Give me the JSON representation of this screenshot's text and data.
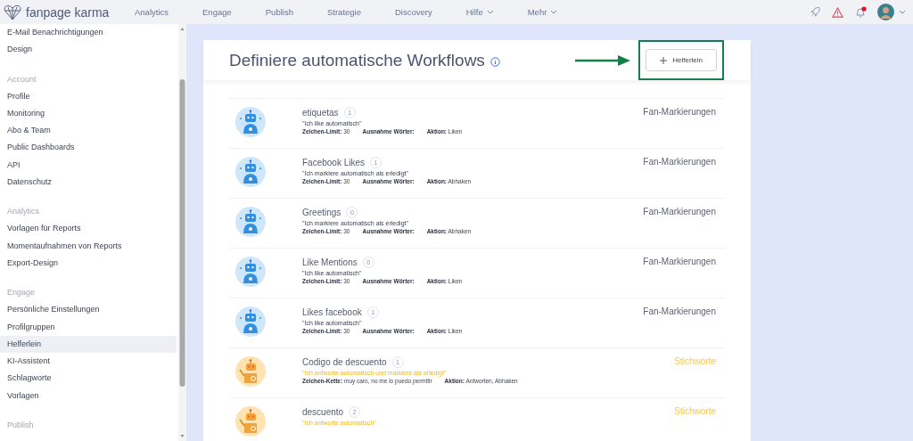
{
  "topbar": {
    "brand": "fanpage karma",
    "nav": [
      {
        "label": "Analytics",
        "dropdown": false
      },
      {
        "label": "Engage",
        "dropdown": false
      },
      {
        "label": "Publish",
        "dropdown": false
      },
      {
        "label": "Strategie",
        "dropdown": false
      },
      {
        "label": "Discovery",
        "dropdown": false
      },
      {
        "label": "Hilfe",
        "dropdown": true
      },
      {
        "label": "Mehr",
        "dropdown": true
      }
    ],
    "has_notification": true
  },
  "sidebar": {
    "sections": [
      {
        "items": [
          {
            "label": "E-Mail Benachrichtigungen",
            "selected": false
          },
          {
            "label": "Design",
            "selected": false
          }
        ]
      },
      {
        "heading": "Account",
        "items": [
          {
            "label": "Profile",
            "selected": false
          },
          {
            "label": "Monitoring",
            "selected": false
          },
          {
            "label": "Abo & Team",
            "selected": false
          },
          {
            "label": "Public Dashboards",
            "selected": false
          },
          {
            "label": "API",
            "selected": false
          },
          {
            "label": "Datenschutz",
            "selected": false
          }
        ]
      },
      {
        "heading": "Analytics",
        "items": [
          {
            "label": "Vorlagen für Reports",
            "selected": false
          },
          {
            "label": "Momentaufnahmen von Reports",
            "selected": false
          },
          {
            "label": "Export-Design",
            "selected": false
          }
        ]
      },
      {
        "heading": "Engage",
        "items": [
          {
            "label": "Persönliche Einstellungen",
            "selected": false
          },
          {
            "label": "Profilgruppen",
            "selected": false
          },
          {
            "label": "Helferlein",
            "selected": true
          },
          {
            "label": "KI-Assistent",
            "selected": false
          },
          {
            "label": "Schlagworte",
            "selected": false
          },
          {
            "label": "Vorlagen",
            "selected": false
          }
        ]
      },
      {
        "heading": "Publish"
      }
    ]
  },
  "page": {
    "title": "Definiere automatische Workflows",
    "add_button": "Helferlein"
  },
  "workflows": [
    {
      "kind": "fan",
      "name": "etiquetas",
      "count": "1",
      "quote": "\"Ich like automatisch\"",
      "details": [
        "**Zeichen-Limit:** 30",
        "**Ausnahme Wörter:**",
        "**Aktion:** Liken"
      ],
      "category": "Fan-Markierungen"
    },
    {
      "kind": "fan",
      "name": "Facebook Likes",
      "count": "1",
      "quote": "\"Ich markiere automatisch als erledigt\"",
      "details": [
        "**Zeichen-Limit:** 30",
        "**Ausnahme Wörter:**",
        "**Aktion:** Abhaken"
      ],
      "category": "Fan-Markierungen"
    },
    {
      "kind": "fan",
      "name": "Greetings",
      "count": "0",
      "quote": "\"Ich markiere automatisch als erledigt\"",
      "details": [
        "**Zeichen-Limit:** 30",
        "**Ausnahme Wörter:**",
        "**Aktion:** Abhaken"
      ],
      "category": "Fan-Markierungen"
    },
    {
      "kind": "fan",
      "name": "Like Mentions",
      "count": "0",
      "quote": "\"Ich like automatisch\"",
      "details": [
        "**Zeichen-Limit:** 30",
        "**Ausnahme Wörter:**",
        "**Aktion:** Liken"
      ],
      "category": "Fan-Markierungen"
    },
    {
      "kind": "fan",
      "name": "Likes facebook",
      "count": "1",
      "quote": "\"Ich like automatisch\"",
      "details": [
        "**Zeichen-Limit:** 30",
        "**Ausnahme Wörter:**",
        "**Aktion:** Liken"
      ],
      "category": "Fan-Markierungen"
    },
    {
      "kind": "keyword",
      "name": "Codigo de descuento",
      "count": "1",
      "quote": "\"Ich antworte automatisch und markiere als erledigt\"",
      "details": [
        "**Zeichen-Kette:** muy caro, no me lo puedo permitir",
        "**Aktion:** Antworten, Abhaken"
      ],
      "category": "Stichworte"
    },
    {
      "kind": "keyword",
      "name": "descuento",
      "count": "2",
      "quote": "\"Ich antworte automatisch\"",
      "category": "Stichworte"
    }
  ]
}
